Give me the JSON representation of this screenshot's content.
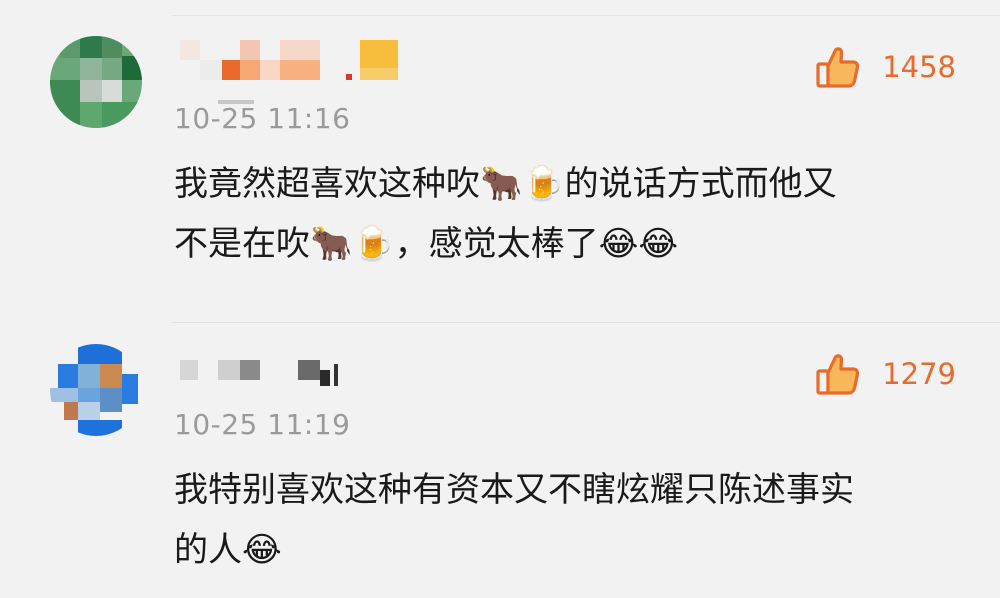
{
  "comments": [
    {
      "timestamp": "10-25 11:16",
      "like_count": "1458",
      "content_line1": "我竟然超喜欢这种吹🐂🍺的说话方式而他又",
      "content_line2": "不是在吹🐂🍺，感觉太棒了😂😂",
      "avatar_icon": "pixelated-avatar-green",
      "like_icon": "thumbs-up-icon"
    },
    {
      "timestamp": "10-25 11:19",
      "like_count": "1279",
      "content_line1": "我特别喜欢这种有资本又不瞎炫耀只陈述事实",
      "content_line2": "的人😂",
      "avatar_icon": "pixelated-avatar-blue",
      "like_icon": "thumbs-up-icon"
    }
  ],
  "colors": {
    "like_accent": "#e86b2c",
    "timestamp": "#9a9a9a",
    "text": "#1a1a1a",
    "background": "#f2f2f2"
  }
}
